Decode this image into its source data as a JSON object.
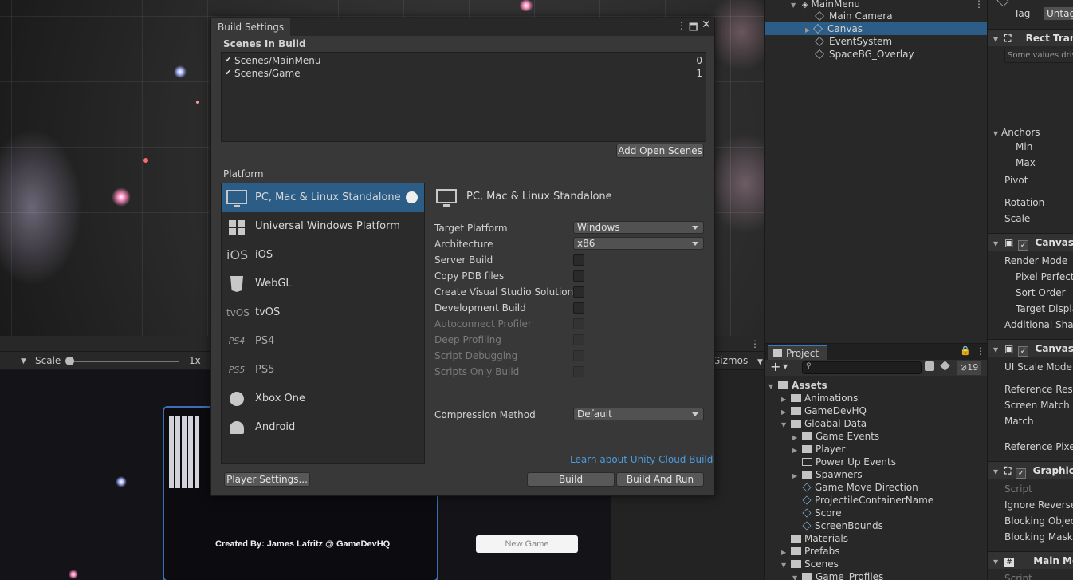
{
  "hierarchy": {
    "root": "MainMenu",
    "items": [
      {
        "label": "Main Camera",
        "selected": false
      },
      {
        "label": "Canvas",
        "selected": true
      },
      {
        "label": "EventSystem",
        "selected": false
      },
      {
        "label": "SpaceBG_Overlay",
        "selected": false
      }
    ]
  },
  "scene_toolbar": {
    "scale_label": "Scale",
    "scale_value": "1x",
    "gizmos_label": "Gizmos"
  },
  "game_view": {
    "credits": "Created By: James Lafritz @ GameDevHQ",
    "new_game_button": "New Game"
  },
  "build_settings": {
    "title": "Build Settings",
    "scenes_in_build_label": "Scenes In Build",
    "scenes": [
      {
        "name": "Scenes/MainMenu",
        "index": "0",
        "checked": true
      },
      {
        "name": "Scenes/Game",
        "index": "1",
        "checked": true
      }
    ],
    "add_open_scenes": "Add Open Scenes",
    "platform_label": "Platform",
    "platforms": [
      {
        "label": "PC, Mac & Linux Standalone",
        "icon": "monitor-icon",
        "selected": true
      },
      {
        "label": "Universal Windows Platform",
        "icon": "windows-icon",
        "selected": false
      },
      {
        "label": "iOS",
        "icon": "ios-icon",
        "icon_text": "iOS",
        "selected": false
      },
      {
        "label": "WebGL",
        "icon": "html5-icon",
        "selected": false
      },
      {
        "label": "tvOS",
        "icon": "tvos-icon",
        "icon_text": "tvOS",
        "selected": false
      },
      {
        "label": "PS4",
        "icon": "ps4-icon",
        "icon_text": "PS4",
        "selected": false
      },
      {
        "label": "PS5",
        "icon": "ps5-icon",
        "icon_text": "PS5",
        "selected": false
      },
      {
        "label": "Xbox One",
        "icon": "xbox-icon",
        "selected": false
      },
      {
        "label": "Android",
        "icon": "android-icon",
        "selected": false
      }
    ],
    "selected_platform_title": "PC, Mac & Linux Standalone",
    "options": {
      "target_platform_label": "Target Platform",
      "target_platform_value": "Windows",
      "architecture_label": "Architecture",
      "architecture_value": "x86",
      "server_build": "Server Build",
      "copy_pdb": "Copy PDB files",
      "create_vs": "Create Visual Studio Solution",
      "development_build": "Development Build",
      "autoconnect_profiler": "Autoconnect Profiler",
      "deep_profiling": "Deep Profiling",
      "script_debugging": "Script Debugging",
      "scripts_only_build": "Scripts Only Build",
      "compression_label": "Compression Method",
      "compression_value": "Default"
    },
    "cloud_build_link": "Learn about Unity Cloud Build",
    "player_settings": "Player Settings...",
    "build": "Build",
    "build_and_run": "Build And Run"
  },
  "project": {
    "tab_label": "Project",
    "hidden_count": "19",
    "tree": [
      {
        "label": "Assets",
        "kind": "folder",
        "bold": true
      },
      {
        "label": "Animations",
        "kind": "folder"
      },
      {
        "label": "GameDevHQ",
        "kind": "folder"
      },
      {
        "label": "Gloabal Data",
        "kind": "folder"
      },
      {
        "label": "Game Events",
        "kind": "folder"
      },
      {
        "label": "Player",
        "kind": "folder"
      },
      {
        "label": "Power Up Events",
        "kind": "folder"
      },
      {
        "label": "Spawners",
        "kind": "folder"
      },
      {
        "label": "Game Move Direction",
        "kind": "asset"
      },
      {
        "label": "ProjectileContainerName",
        "kind": "asset"
      },
      {
        "label": "Score",
        "kind": "asset"
      },
      {
        "label": "ScreenBounds",
        "kind": "asset"
      },
      {
        "label": "Materials",
        "kind": "folder"
      },
      {
        "label": "Prefabs",
        "kind": "folder"
      },
      {
        "label": "Scenes",
        "kind": "folder"
      },
      {
        "label": "Game_Profiles",
        "kind": "folder"
      }
    ]
  },
  "inspector": {
    "tag_label": "Tag",
    "tag_value": "Untagged",
    "rect_transform": "Rect Transform",
    "some_values": "Some values driven by Canvas.",
    "anchors": "Anchors",
    "min": "Min",
    "max": "Max",
    "pivot": "Pivot",
    "rotation": "Rotation",
    "scale": "Scale",
    "canvas": "Canvas",
    "render_mode": "Render Mode",
    "pixel_perfect": "Pixel Perfect",
    "sort_order": "Sort Order",
    "target_display": "Target Display",
    "additional_shader": "Additional Shader Channels",
    "canvas_scaler": "Canvas Scaler",
    "ui_scale_mode": "UI Scale Mode",
    "reference_resolution": "Reference Resolution",
    "screen_match_mode": "Screen Match Mode",
    "match": "Match",
    "reference_pixels": "Reference Pixels Per Unit",
    "graphic_raycaster": "Graphic Raycaster",
    "script": "Script",
    "ignore_reversed": "Ignore Reversed Graphics",
    "blocking_objects": "Blocking Objects",
    "blocking_mask": "Blocking Mask",
    "main_menu": "Main Menu",
    "script2": "Script"
  }
}
